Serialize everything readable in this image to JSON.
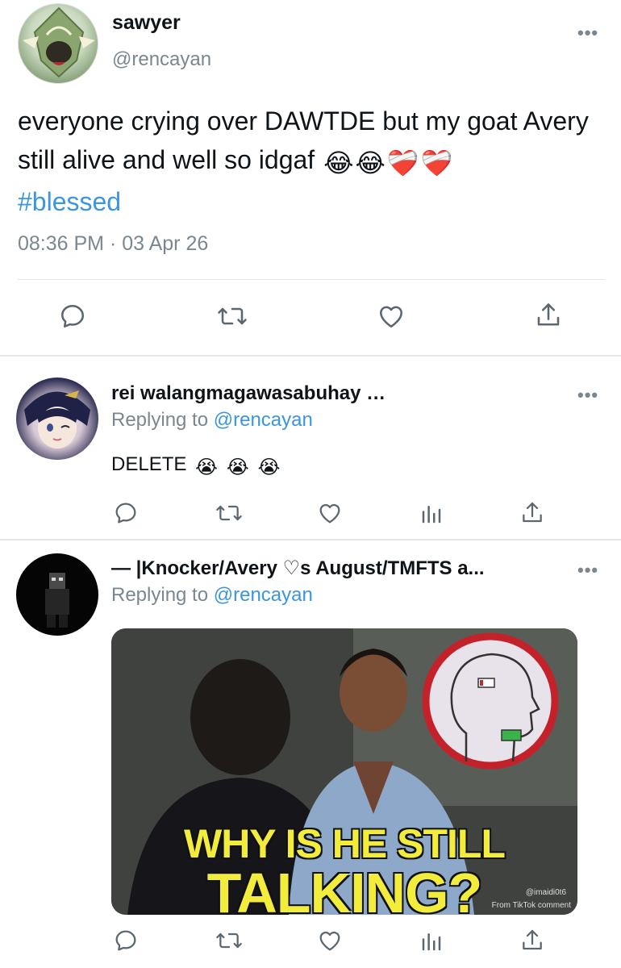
{
  "main_tweet": {
    "display_name": "sawyer",
    "handle": "@rencayan",
    "text": "everyone crying over DAWTDE but my goat Avery still alive and well so idgaf",
    "emojis": [
      "😂",
      "😂",
      "❤️‍🩹",
      "❤️‍🩹"
    ],
    "hashtag": "#blessed",
    "timestamp": "08:36 PM · 03 Apr 26",
    "more_menu": "•••",
    "actions": [
      "reply-icon",
      "retweet-icon",
      "like-icon",
      "share-icon"
    ]
  },
  "replies": [
    {
      "display_name": "rei walangmagawasabuhay …",
      "replying_label": "Replying to",
      "replying_to": "@rencayan",
      "text": "DELETE",
      "emojis": [
        "😭",
        "😭",
        "😭"
      ],
      "more_menu": "•••",
      "actions": [
        "reply-icon",
        "retweet-icon",
        "like-icon",
        "analytics-icon",
        "share-icon"
      ]
    },
    {
      "display_name": "— |Knocker/Avery ♡s August/TMFTS a...",
      "replying_label": "Replying to",
      "replying_to": "@rencayan",
      "more_menu": "•••",
      "media": {
        "caption_line1": "WHY IS HE STILL",
        "caption_line2": "TALKING?",
        "watermark_handle": "@imaidi0t6",
        "watermark_source": "From TikTok comment"
      },
      "actions": [
        "reply-icon",
        "retweet-icon",
        "like-icon",
        "analytics-icon",
        "share-icon"
      ]
    }
  ],
  "colors": {
    "link": "#3b95e0",
    "secondary_text": "#7b8790",
    "icon": "#5b6770",
    "divider": "#e3e7ea",
    "caption": "#f2ec3c"
  }
}
